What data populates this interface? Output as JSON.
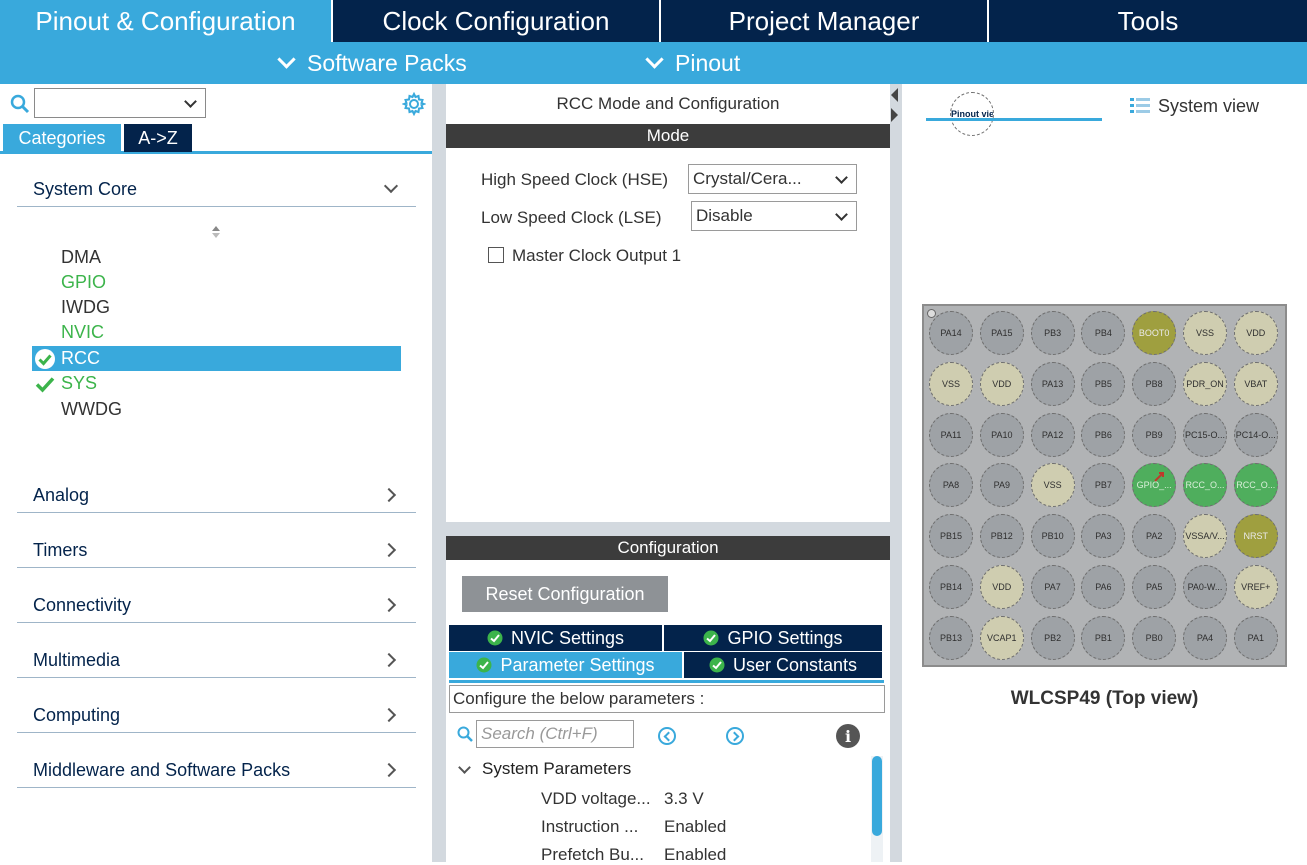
{
  "top_tabs": [
    {
      "label": "Pinout & Configuration"
    },
    {
      "label": "Clock Configuration"
    },
    {
      "label": "Project Manager"
    },
    {
      "label": "Tools"
    }
  ],
  "sub_menu": {
    "software_packs": "Software Packs",
    "pinout": "Pinout"
  },
  "left": {
    "search_value": "",
    "tabs": {
      "categories": "Categories",
      "az": "A->Z"
    },
    "system_core": "System Core",
    "items": [
      {
        "label": "DMA",
        "state": "plain"
      },
      {
        "label": "GPIO",
        "state": "green"
      },
      {
        "label": "IWDG",
        "state": "plain"
      },
      {
        "label": "NVIC",
        "state": "green"
      },
      {
        "label": "RCC",
        "state": "selected"
      },
      {
        "label": "SYS",
        "state": "checked"
      },
      {
        "label": "WWDG",
        "state": "plain"
      }
    ],
    "sections": [
      "Analog",
      "Timers",
      "Connectivity",
      "Multimedia",
      "Computing",
      "Middleware and Software Packs"
    ]
  },
  "mode": {
    "title": "RCC Mode and Configuration",
    "header": "Mode",
    "hse_label": "High Speed Clock (HSE)",
    "hse_value": "Crystal/Cera...",
    "lse_label": "Low Speed Clock (LSE)",
    "lse_value": "Disable",
    "mco_label": "Master Clock Output 1"
  },
  "configuration": {
    "header": "Configuration",
    "reset_label": "Reset Configuration",
    "tabs": {
      "nvic": "NVIC Settings",
      "gpio": "GPIO Settings",
      "param": "Parameter Settings",
      "user": "User Constants"
    },
    "configure_text": "Configure the below parameters :",
    "search_placeholder": "Search (Ctrl+F)",
    "group": "System Parameters",
    "params": [
      {
        "name": "VDD voltage...",
        "value": "3.3 V"
      },
      {
        "name": "Instruction ...",
        "value": "Enabled"
      },
      {
        "name": "Prefetch Bu...",
        "value": "Enabled"
      }
    ]
  },
  "right": {
    "pinout_view": "Pinout view",
    "system_view": "System view",
    "package": "WLCSP49 (Top view)",
    "colors": {
      "gray": "#9ea2a6",
      "beige": "#cfcdb0",
      "olive": "#9f9f3f",
      "green": "#4fae5d"
    },
    "pins": [
      [
        [
          "PA14",
          "gray"
        ],
        [
          "PA15",
          "gray"
        ],
        [
          "PB3",
          "gray"
        ],
        [
          "PB4",
          "gray"
        ],
        [
          "BOOT0",
          "olive"
        ],
        [
          "VSS",
          "beige"
        ],
        [
          "VDD",
          "beige"
        ]
      ],
      [
        [
          "VSS",
          "beige"
        ],
        [
          "VDD",
          "beige"
        ],
        [
          "PA13",
          "gray"
        ],
        [
          "PB5",
          "gray"
        ],
        [
          "PB8",
          "gray"
        ],
        [
          "PDR_ON",
          "beige"
        ],
        [
          "VBAT",
          "beige"
        ]
      ],
      [
        [
          "PA11",
          "gray"
        ],
        [
          "PA10",
          "gray"
        ],
        [
          "PA12",
          "gray"
        ],
        [
          "PB6",
          "gray"
        ],
        [
          "PB9",
          "gray"
        ],
        [
          "PC15-O...",
          "gray"
        ],
        [
          "PC14-O...",
          "gray"
        ]
      ],
      [
        [
          "PA8",
          "gray"
        ],
        [
          "PA9",
          "gray"
        ],
        [
          "VSS",
          "beige"
        ],
        [
          "PB7",
          "gray"
        ],
        [
          "GPIO_...",
          "green"
        ],
        [
          "RCC_O...",
          "green"
        ],
        [
          "RCC_O...",
          "green"
        ]
      ],
      [
        [
          "PB15",
          "gray"
        ],
        [
          "PB12",
          "gray"
        ],
        [
          "PB10",
          "gray"
        ],
        [
          "PA3",
          "gray"
        ],
        [
          "PA2",
          "gray"
        ],
        [
          "VSSA/V...",
          "beige"
        ],
        [
          "NRST",
          "olive"
        ]
      ],
      [
        [
          "PB14",
          "gray"
        ],
        [
          "VDD",
          "beige"
        ],
        [
          "PA7",
          "gray"
        ],
        [
          "PA6",
          "gray"
        ],
        [
          "PA5",
          "gray"
        ],
        [
          "PA0-W...",
          "gray"
        ],
        [
          "VREF+",
          "beige"
        ]
      ],
      [
        [
          "PB13",
          "gray"
        ],
        [
          "VCAP1",
          "beige"
        ],
        [
          "PB2",
          "gray"
        ],
        [
          "PB1",
          "gray"
        ],
        [
          "PB0",
          "gray"
        ],
        [
          "PA4",
          "gray"
        ],
        [
          "PA1",
          "gray"
        ]
      ]
    ]
  }
}
